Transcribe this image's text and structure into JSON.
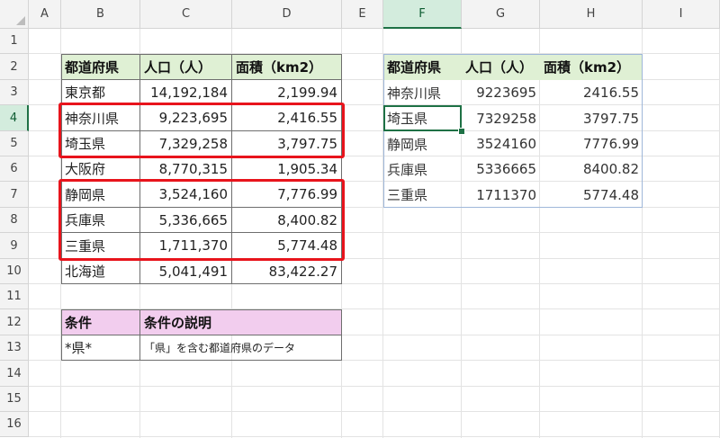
{
  "columns": [
    "A",
    "B",
    "C",
    "D",
    "E",
    "F",
    "G",
    "H",
    "I"
  ],
  "rows": [
    "1",
    "2",
    "3",
    "4",
    "5",
    "6",
    "7",
    "8",
    "9",
    "10",
    "11",
    "12",
    "13",
    "14",
    "15",
    "16"
  ],
  "selected_column": "F",
  "selected_row": "4",
  "left_table": {
    "headers": [
      "都道府県",
      "人口（人）",
      "面積（km2）"
    ],
    "rows": [
      [
        "東京都",
        "14,192,184",
        "2,199.94"
      ],
      [
        "神奈川県",
        "9,223,695",
        "2,416.55"
      ],
      [
        "埼玉県",
        "7,329,258",
        "3,797.75"
      ],
      [
        "大阪府",
        "8,770,315",
        "1,905.34"
      ],
      [
        "静岡県",
        "3,524,160",
        "7,776.99"
      ],
      [
        "兵庫県",
        "5,336,665",
        "8,400.82"
      ],
      [
        "三重県",
        "1,711,370",
        "5,774.48"
      ],
      [
        "北海道",
        "5,041,491",
        "83,422.27"
      ]
    ]
  },
  "criteria": {
    "headers": [
      "条件",
      "条件の説明"
    ],
    "row": [
      "*県*",
      "「県」を含む都道府県のデータ"
    ]
  },
  "result_table": {
    "headers": [
      "都道府県",
      "人口（人）",
      "面積（km2）"
    ],
    "rows": [
      [
        "神奈川県",
        "9223695",
        "2416.55"
      ],
      [
        "埼玉県",
        "7329258",
        "3797.75"
      ],
      [
        "静岡県",
        "3524160",
        "7776.99"
      ],
      [
        "兵庫県",
        "5336665",
        "8400.82"
      ],
      [
        "三重県",
        "1711370",
        "5774.48"
      ]
    ]
  },
  "colors": {
    "header_green": "#dff0d4",
    "header_pink": "#f2cdee",
    "highlight_red": "#e8141c",
    "selection_green": "#1e7145"
  }
}
